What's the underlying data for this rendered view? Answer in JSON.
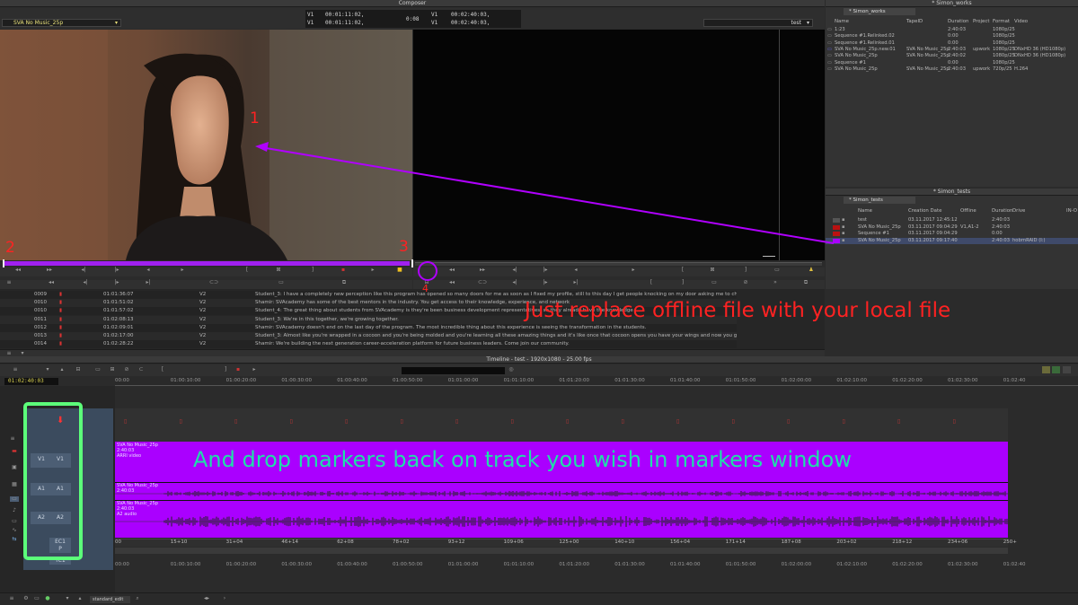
{
  "composer": {
    "title": "Composer",
    "source_bin": "SVA No Music_25p",
    "record_seq": "test",
    "tc_v1_a": "00:01:11:02,",
    "tc_v1_b": "00:01:11:02,",
    "tc_dur": "0:08",
    "tc_v1_c": "00:02:40:03,",
    "tc_v1_d": "00:02:40:03,",
    "label_v1": "V1"
  },
  "bin_works": {
    "title": "* Simon_works",
    "tab": "* Simon_works",
    "cols": [
      "Name",
      "TapeID",
      "Duration",
      "Project",
      "Format",
      "Video"
    ],
    "rows": [
      [
        "1:23",
        "",
        "2:40:03",
        "",
        "1080p/25",
        ""
      ],
      [
        "Sequence #1.Relinked.02",
        "",
        "0:00",
        "",
        "1080p/25",
        ""
      ],
      [
        "Sequence #1.Relinked.01",
        "",
        "0:00",
        "",
        "1080p/25",
        ""
      ],
      [
        "SVA No Music_25p.new.01",
        "SVA No Music_25p",
        "2:40:03",
        "upwork",
        "1080p/25",
        "DNxHD 36 (HD1080p)"
      ],
      [
        "SVA No Music_25p",
        "SVA No Music_25p",
        "2:40:02",
        "",
        "1080p/25",
        "DNxHD 36 (HD1080p)"
      ],
      [
        "Sequence #1",
        "",
        "0:00",
        "",
        "1080p/25",
        ""
      ],
      [
        "SVA No Music_25p",
        "SVA No Music_25p",
        "2:40:03",
        "upwork",
        "720p/25",
        "H.264"
      ]
    ]
  },
  "bin_tests": {
    "title": "* Simon_tests",
    "tab": "* Simon_tests",
    "cols": [
      "Name",
      "Creation Date",
      "Offline",
      "Duration",
      "Drive",
      "IN-O"
    ],
    "rows": [
      [
        "test",
        "03.11.2017 12:45:12",
        "",
        "2:40:03",
        ""
      ],
      [
        "SVA No Music_25p",
        "03.11.2017 09:04:29",
        "V1,A1-2",
        "2:40:03",
        ""
      ],
      [
        "Sequence #1",
        "03.11.2017 09:04:29",
        "",
        "0:00",
        ""
      ],
      [
        "SVA No Music_25p",
        "03.11.2017 09:17:40",
        "",
        "2:40:03",
        "hobrnRAID (I:)"
      ]
    ]
  },
  "markers": [
    [
      "0009",
      "01:01:36:07",
      "V2",
      "Student_3: I have a completely new perception like this program has opened so many doors for me as soon as I fixed my profile, still to this day I get people knocking on my door asking me to check out"
    ],
    [
      "0010",
      "01:01:51:02",
      "V2",
      "Shamir: SVAcademy has some of the best mentors in the industry. You get access to their knowledge, experience, and network"
    ],
    [
      "0010",
      "01:01:57:02",
      "V2",
      "Student_4: The great thing about students from SVAcademy is they're been business development representatives, so they already have the knowledge"
    ],
    [
      "0011",
      "01:02:08:13",
      "V2",
      "Student_3: We're in this together, we're growing together."
    ],
    [
      "0012",
      "01:02:09:01",
      "V2",
      "Shamir: SVAcademy doesn't end on the last day of the program. The most incredible thing about this experience is seeing the transformation in the students."
    ],
    [
      "0013",
      "01:02:17:00",
      "V2",
      "Student_3: Almost like you're wrapped in a cocoon and you're being molded and you're learning all these amazing things and it's like once that cocoon opens you have your wings and now you graduate"
    ],
    [
      "0014",
      "01:02:28:22",
      "V2",
      "Shamir: We're building the next generation career-acceleration platform for future business leaders. Come join our community."
    ]
  ],
  "timeline": {
    "title": "Timeline - test - 1920x1080 - 25.00 fps",
    "position_tc": "01:02:40:03",
    "ruler": [
      "00:00",
      "01:00:10:00",
      "01:00:20:00",
      "01:00:30:00",
      "01:00:40:00",
      "01:00:50:00",
      "01:01:00:00",
      "01:01:10:00",
      "01:01:20:00",
      "01:01:30:00",
      "01:01:40:00",
      "01:01:50:00",
      "01:02:00:00",
      "01:02:10:00",
      "01:02:20:00",
      "01:02:30:00",
      "01:02:40"
    ],
    "footage": [
      "00",
      "15+10",
      "31+04",
      "46+14",
      "62+08",
      "78+02",
      "93+12",
      "109+06",
      "125+00",
      "140+10",
      "156+04",
      "171+14",
      "187+08",
      "203+02",
      "218+12",
      "234+06",
      "250+"
    ],
    "track_v1": "V1",
    "track_a1": "A1",
    "track_a2": "A2",
    "track_ec1": "EC1",
    "track_p": "P",
    "track_tc1": "TC1",
    "clip_v1_name": "SVA No Music_25p",
    "clip_v1_sub1": "2:40:03",
    "clip_v1_sub2": "ARRI video",
    "clip_a1_name": "SVA No Music_25p",
    "clip_a1_sub": "2:40:03",
    "clip_a2_name": "SVA No Music_25p",
    "clip_a2_sub1": "2:40:03",
    "clip_a2_sub2": "A2 audio",
    "bottom_tab": "standard_edit"
  },
  "annotations": {
    "n1": "1",
    "n2": "2",
    "n3": "3",
    "n4": "4",
    "replace": "Just replace offline file with your local file",
    "drop": "And drop markers back on track you wish in markers window"
  },
  "colors": {
    "annotation_red": "#ff2222",
    "annotation_purple": "#b000ff",
    "annotation_cyan": "#1ee0a8",
    "highlight_green": "#5cff7a",
    "clip_purple": "#aa00ff"
  }
}
